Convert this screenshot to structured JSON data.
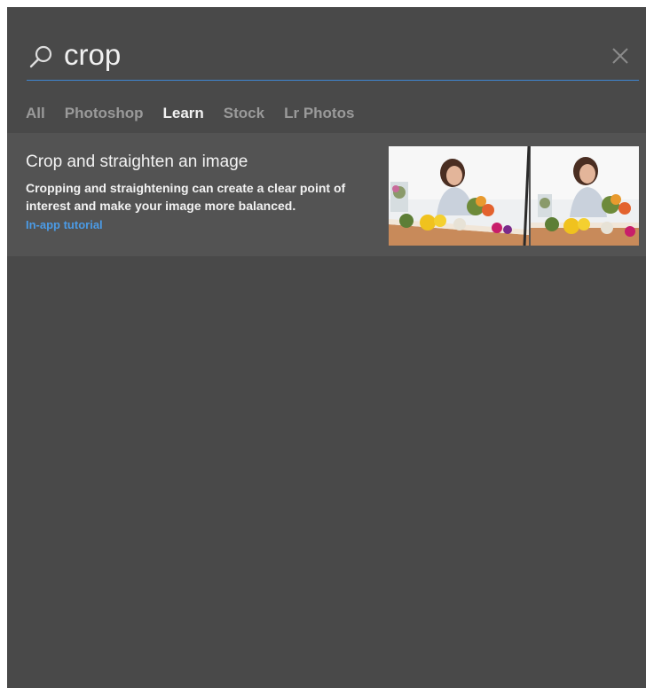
{
  "search": {
    "query": "crop",
    "icon": "search-icon",
    "close_icon": "close-icon",
    "underline_color": "#3f86d1"
  },
  "tabs": [
    {
      "label": "All",
      "active": false
    },
    {
      "label": "Photoshop",
      "active": false
    },
    {
      "label": "Learn",
      "active": true
    },
    {
      "label": "Stock",
      "active": false
    },
    {
      "label": "Lr Photos",
      "active": false
    }
  ],
  "results": [
    {
      "title": "Crop and straighten an image",
      "description": "Cropping and straightening can create a clear point of interest and make your image more balanced.",
      "link": "In-app tutorial",
      "thumbnail_icon": "tutorial-thumbnail"
    }
  ],
  "colors": {
    "panel_bg": "#494949",
    "card_bg": "#535353",
    "link": "#4b9be6",
    "text": "#f2f2f2",
    "tab_inactive": "#9a9a9a"
  }
}
